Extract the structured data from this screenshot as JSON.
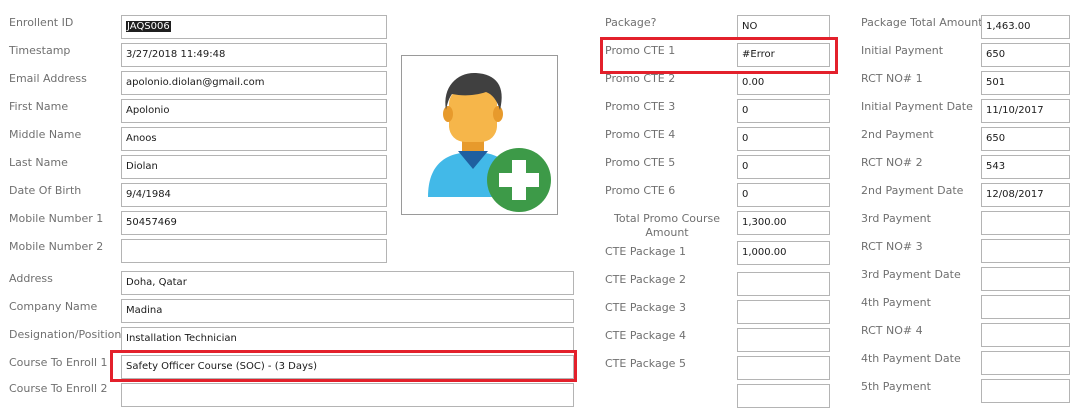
{
  "left": {
    "enrollment_id": {
      "label": "Enrollent ID",
      "value": "JAQS006"
    },
    "timestamp": {
      "label": "Timestamp",
      "value": "3/27/2018 11:49:48"
    },
    "email": {
      "label": "Email Address",
      "value": "apolonio.diolan@gmail.com"
    },
    "first_name": {
      "label": "First Name",
      "value": "Apolonio"
    },
    "middle_name": {
      "label": "Middle Name",
      "value": "Anoos"
    },
    "last_name": {
      "label": "Last Name",
      "value": "Diolan"
    },
    "dob": {
      "label": "Date Of Birth",
      "value": "9/4/1984"
    },
    "mobile1": {
      "label": "Mobile Number 1",
      "value": "50457469"
    },
    "mobile2": {
      "label": "Mobile Number 2",
      "value": ""
    },
    "address": {
      "label": "Address",
      "value": "Doha, Qatar"
    },
    "company": {
      "label": "Company Name",
      "value": "Madina"
    },
    "designation": {
      "label": "Designation/Position",
      "value": "Installation Technician"
    },
    "course1": {
      "label": "Course To Enroll 1",
      "value": "Safety Officer Course (SOC) - (3 Days)"
    },
    "course2": {
      "label": "Course To Enroll 2",
      "value": ""
    }
  },
  "photo": {
    "icon": "add-user-icon",
    "colors": {
      "skin": "#f6b64a",
      "hair": "#404040",
      "shirt": "#42b9e8",
      "plus": "#3d9a48"
    }
  },
  "middle": {
    "package": {
      "label": "Package?",
      "value": "NO"
    },
    "promo1": {
      "label": "Promo CTE 1",
      "value": "#Error"
    },
    "promo2": {
      "label": "Promo CTE 2",
      "value": "0.00"
    },
    "promo3": {
      "label": "Promo CTE 3",
      "value": "0"
    },
    "promo4": {
      "label": "Promo CTE 4",
      "value": "0"
    },
    "promo5": {
      "label": "Promo CTE 5",
      "value": "0"
    },
    "promo6": {
      "label": "Promo CTE 6",
      "value": "0"
    },
    "total_promo": {
      "label": "Total Promo Course Amount",
      "value": "1,300.00"
    },
    "pkg1": {
      "label": "CTE Package 1",
      "value": "1,000.00"
    },
    "pkg2": {
      "label": "CTE Package 2",
      "value": ""
    },
    "pkg3": {
      "label": "CTE Package 3",
      "value": ""
    },
    "pkg4": {
      "label": "CTE Package 4",
      "value": ""
    },
    "pkg5": {
      "label": "CTE Package 5",
      "value": ""
    }
  },
  "right": {
    "pkg_total": {
      "label": "Package Total Amount",
      "value": "1,463.00"
    },
    "initial_payment": {
      "label": "Initial Payment",
      "value": "650"
    },
    "rct1": {
      "label": "RCT NO# 1",
      "value": "501"
    },
    "initial_date": {
      "label": "Initial Payment Date",
      "value": "11/10/2017"
    },
    "payment2": {
      "label": "2nd Payment",
      "value": "650"
    },
    "rct2": {
      "label": "RCT NO# 2",
      "value": "543"
    },
    "payment2_date": {
      "label": "2nd Payment Date",
      "value": "12/08/2017"
    },
    "payment3": {
      "label": "3rd Payment",
      "value": ""
    },
    "rct3": {
      "label": "RCT NO# 3",
      "value": ""
    },
    "payment3_date": {
      "label": "3rd Payment Date",
      "value": ""
    },
    "payment4": {
      "label": "4th Payment",
      "value": ""
    },
    "rct4": {
      "label": "RCT NO# 4",
      "value": ""
    },
    "payment4_date": {
      "label": "4th Payment Date",
      "value": ""
    },
    "payment5": {
      "label": "5th Payment",
      "value": ""
    }
  },
  "highlight_color": "#e3202b"
}
